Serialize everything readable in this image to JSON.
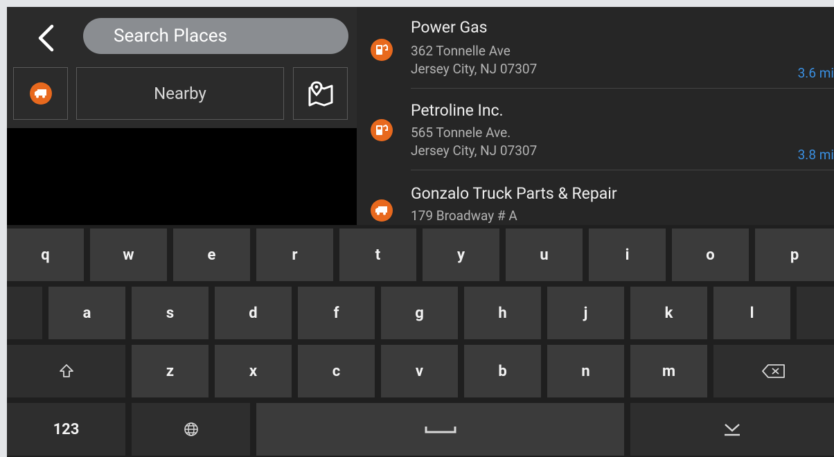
{
  "search": {
    "placeholder": "Search Places"
  },
  "filter": {
    "nearby_label": "Nearby"
  },
  "results": [
    {
      "name": "Power Gas",
      "address_line1": "362 Tonnelle Ave",
      "address_line2": "Jersey City, NJ 07307",
      "distance": "3.6 mi",
      "icon": "gas-station-icon"
    },
    {
      "name": "Petroline Inc.",
      "address_line1": "565 Tonnele Ave.",
      "address_line2": "Jersey City, NJ 07307",
      "distance": "3.8 mi",
      "icon": "gas-station-icon"
    },
    {
      "name": "Gonzalo Truck Parts & Repair",
      "address_line1": "179 Broadway # A",
      "address_line2": "",
      "distance": "",
      "icon": "truck-icon"
    }
  ],
  "keyboard": {
    "row1": [
      "q",
      "w",
      "e",
      "r",
      "t",
      "y",
      "u",
      "i",
      "o",
      "p"
    ],
    "row2": [
      "a",
      "s",
      "d",
      "f",
      "g",
      "h",
      "j",
      "k",
      "l"
    ],
    "row3": [
      "z",
      "x",
      "c",
      "v",
      "b",
      "n",
      "m"
    ],
    "numbers_label": "123"
  },
  "colors": {
    "accent_orange": "#e8691e",
    "distance_blue": "#3a8fe0"
  }
}
